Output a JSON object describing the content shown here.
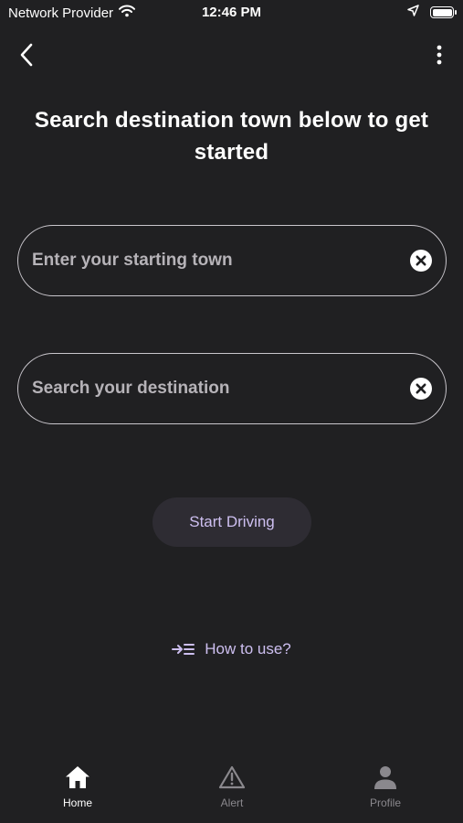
{
  "status_bar": {
    "carrier": "Network Provider",
    "time": "12:46 PM"
  },
  "header": {
    "title": "Search destination town below to get started"
  },
  "fields": {
    "start_placeholder": "Enter your starting town",
    "start_value": "",
    "destination_placeholder": "Search your destination",
    "destination_value": ""
  },
  "actions": {
    "start_label": "Start Driving",
    "howto_label": "How to use?"
  },
  "tabbar": {
    "tabs": [
      {
        "label": "Home",
        "icon": "home-icon",
        "active": true
      },
      {
        "label": "Alert",
        "icon": "warning-icon",
        "active": false
      },
      {
        "label": "Profile",
        "icon": "person-icon",
        "active": false
      }
    ]
  },
  "colors": {
    "background": "#202022",
    "accent": "#cdbff0",
    "button_bg": "#2e2c33",
    "field_border": "#c9c6cc"
  }
}
